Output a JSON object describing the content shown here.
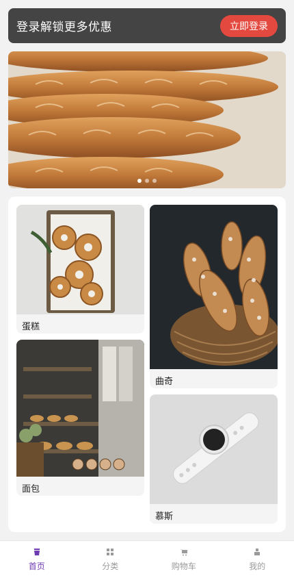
{
  "login_bar": {
    "text": "登录解锁更多优惠",
    "button_label": "立即登录"
  },
  "carousel": {
    "slide_count": 3,
    "active_index": 0
  },
  "products": [
    {
      "label": "蛋糕",
      "image": "bagels-basket"
    },
    {
      "label": "面包",
      "image": "bakery-shop"
    },
    {
      "label": "曲奇",
      "image": "bread-basket"
    },
    {
      "label": "慕斯",
      "image": "smartwatch"
    }
  ],
  "tabs": [
    {
      "label": "首页",
      "icon": "home-icon",
      "active": true
    },
    {
      "label": "分类",
      "icon": "grid-icon",
      "active": false
    },
    {
      "label": "购物车",
      "icon": "cart-icon",
      "active": false
    },
    {
      "label": "我的",
      "icon": "user-icon",
      "active": false
    }
  ],
  "colors": {
    "accent": "#6f3bb0",
    "login_button": "#e4493f",
    "login_bar": "#444444"
  }
}
